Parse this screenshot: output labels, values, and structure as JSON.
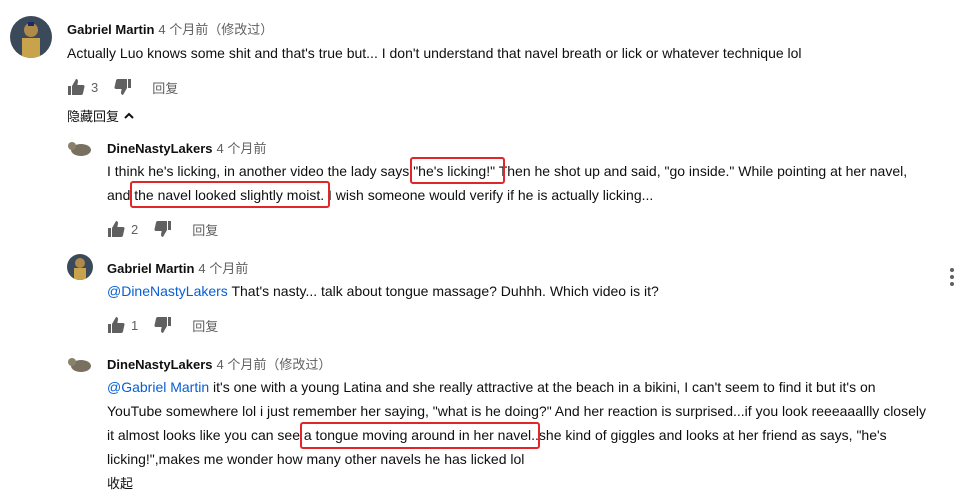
{
  "comments": [
    {
      "author": "Gabriel Martin",
      "time": "4 个月前（修改过）",
      "text": "Actually Luo knows some shit and that's true but... I don't understand that navel breath or lick or whatever technique lol",
      "likes": "3",
      "reply": "回复"
    },
    {
      "author": "DineNastyLakers",
      "time": "4 个月前",
      "line1_a": "I think he's licking, in another video the lady says ",
      "line1_hl": "\"he's licking!\"",
      "line1_b": " Then he shot up and said, \"go inside.\" While pointing at her navel,",
      "line2_a": "and ",
      "line2_hl": "the navel looked slightly moist",
      "line2_b": ". I wish someone would verify if he is actually licking...",
      "likes": "2",
      "reply": "回复"
    },
    {
      "author": "Gabriel Martin",
      "time": "4 个月前",
      "mention": "@DineNastyLakers",
      "text": " That's nasty... talk about tongue massage? Duhhh. Which video is it?",
      "likes": "1",
      "reply": "回复"
    },
    {
      "author": "DineNastyLakers",
      "time": "4 个月前（修改过）",
      "mention": "@Gabriel Martin",
      "line1": " it's one with a young Latina and she really attractive at the beach in a bikini, I can't seem to find it but it's on",
      "line2": "YouTube somewhere lol i just remember her saying, \"what is he doing?\" And her reaction is surprised...if you look reeeaaallly closely",
      "line3_a": "it almost looks like you can see ",
      "line3_hl": "a tongue moving around in her navel",
      "line3_b": "..she kind of giggles and looks at her friend as says, \"he's",
      "line4": "licking!\",makes me wonder how many other navels he has licked lol",
      "collapse": "收起"
    }
  ],
  "hide_replies": "隐藏回复",
  "colors": {
    "highlight": "#e0262a",
    "mention": "#065fd4",
    "meta": "#606060"
  },
  "icons": [
    "like-icon",
    "dislike-icon",
    "chevron-up-icon",
    "more-vert-icon"
  ]
}
